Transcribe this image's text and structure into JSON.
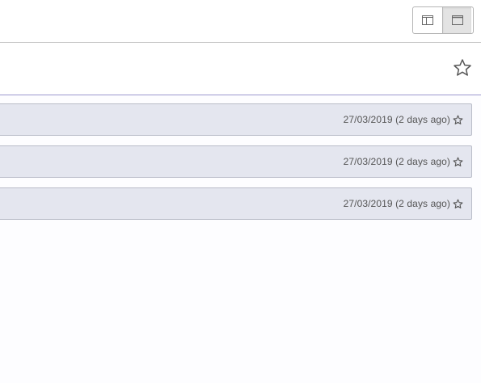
{
  "toolbar": {
    "view_modes": [
      {
        "icon": "split-pane-icon",
        "active": false
      },
      {
        "icon": "full-pane-icon",
        "active": true
      }
    ]
  },
  "header": {
    "favorite_icon": "star-outline-icon"
  },
  "messages": [
    {
      "date": "27/03/2019 (2 days ago)",
      "icon": "star-outline-icon"
    },
    {
      "date": "27/03/2019 (2 days ago)",
      "icon": "star-outline-icon"
    },
    {
      "date": "27/03/2019 (2 days ago)",
      "icon": "star-outline-icon"
    }
  ],
  "colors": {
    "row_background": "#e4e6ef",
    "row_border": "#b9bcc8",
    "content_top_border": "#9c98cf",
    "active_toggle": "#e3e3e3"
  }
}
